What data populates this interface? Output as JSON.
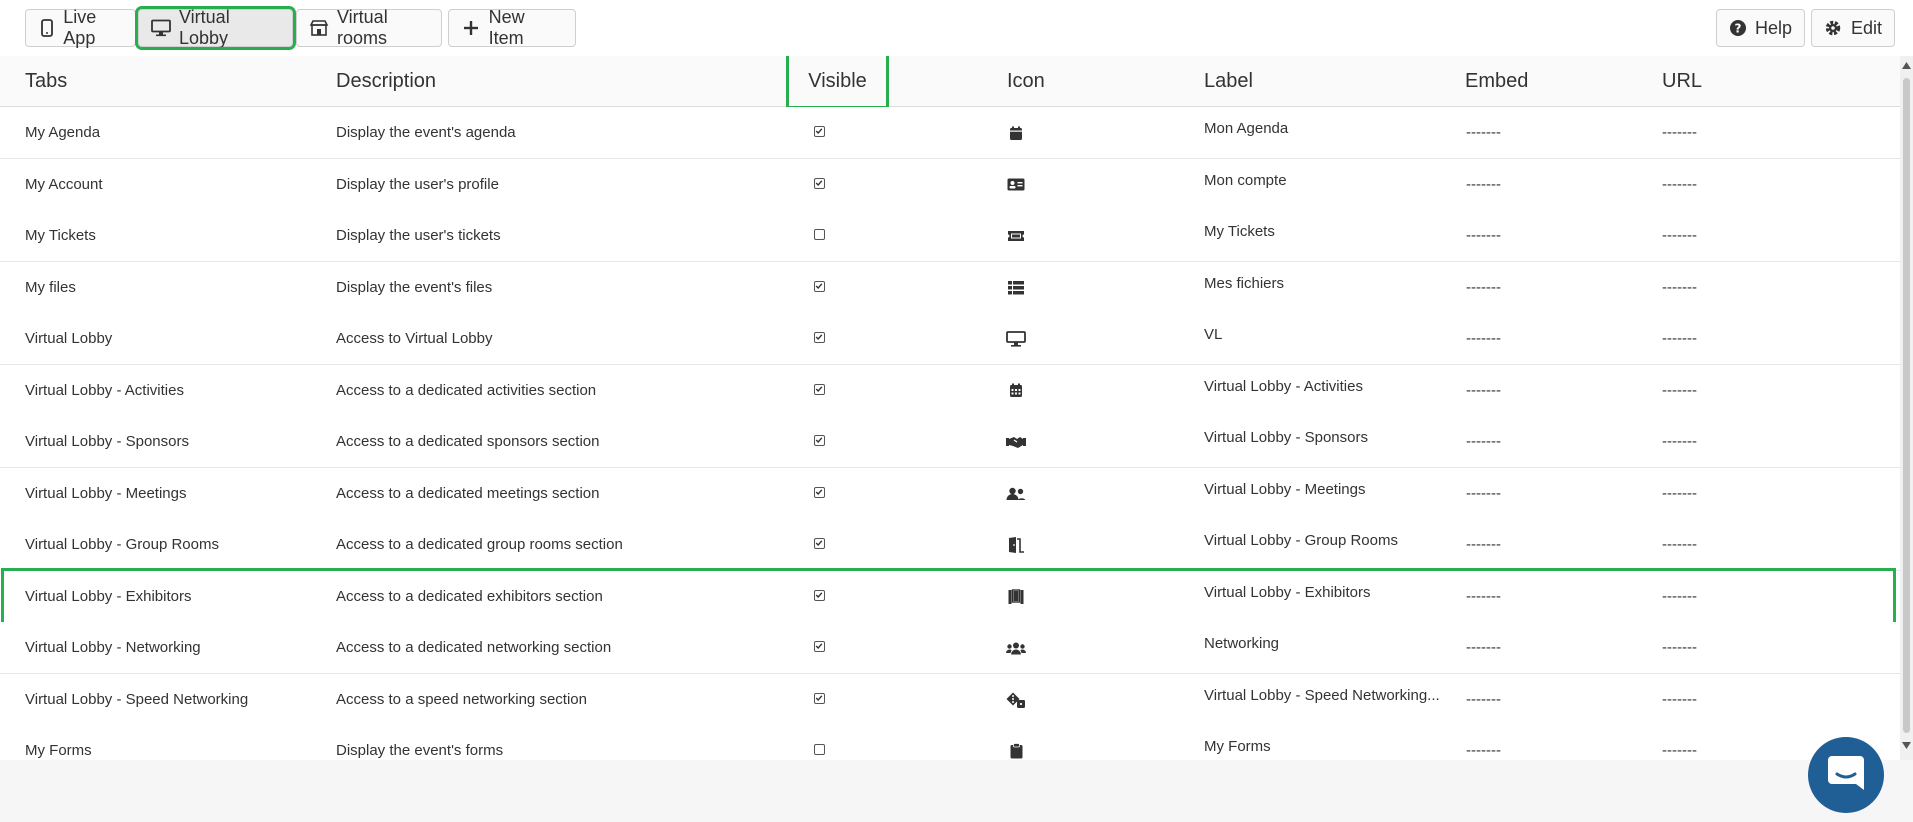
{
  "toolbar": {
    "live_app": "Live App",
    "virtual_lobby": "Virtual Lobby",
    "virtual_rooms": "Virtual rooms",
    "new_item": "New Item",
    "help": "Help",
    "edit": "Edit"
  },
  "table": {
    "headers": {
      "tabs": "Tabs",
      "description": "Description",
      "visible": "Visible",
      "icon": "Icon",
      "label": "Label",
      "embed": "Embed",
      "url": "URL"
    },
    "rows": [
      {
        "tab": "My Agenda",
        "description": "Display the event's agenda",
        "visible": true,
        "icon": "calendar-icon",
        "label": "Mon Agenda",
        "embed": "-------",
        "url": "-------"
      },
      {
        "tab": "My Account",
        "description": "Display the user's profile",
        "visible": true,
        "icon": "id-card-icon",
        "label": "Mon compte",
        "embed": "-------",
        "url": "-------"
      },
      {
        "tab": "My Tickets",
        "description": "Display the user's tickets",
        "visible": false,
        "icon": "ticket-icon",
        "label": "My Tickets",
        "embed": "-------",
        "url": "-------"
      },
      {
        "tab": "My files",
        "description": "Display the event's files",
        "visible": true,
        "icon": "list-icon",
        "label": "Mes fichiers",
        "embed": "-------",
        "url": "-------"
      },
      {
        "tab": "Virtual Lobby",
        "description": "Access to Virtual Lobby",
        "visible": true,
        "icon": "desktop-icon",
        "label": "VL",
        "embed": "-------",
        "url": "-------"
      },
      {
        "tab": "Virtual Lobby - Activities",
        "description": "Access to a dedicated activities section",
        "visible": true,
        "icon": "calendar-grid-icon",
        "label": "Virtual Lobby - Activities",
        "embed": "-------",
        "url": "-------"
      },
      {
        "tab": "Virtual Lobby - Sponsors",
        "description": "Access to a dedicated sponsors section",
        "visible": true,
        "icon": "handshake-icon",
        "label": "Virtual Lobby - Sponsors",
        "embed": "-------",
        "url": "-------"
      },
      {
        "tab": "Virtual Lobby - Meetings",
        "description": "Access to a dedicated meetings section",
        "visible": true,
        "icon": "user-friends-icon",
        "label": "Virtual Lobby - Meetings",
        "embed": "-------",
        "url": "-------"
      },
      {
        "tab": "Virtual Lobby - Group Rooms",
        "description": "Access to a dedicated group rooms section",
        "visible": true,
        "icon": "door-open-icon",
        "label": "Virtual Lobby - Group Rooms",
        "embed": "-------",
        "url": "-------"
      },
      {
        "tab": "Virtual Lobby - Exhibitors",
        "description": "Access to a dedicated exhibitors section",
        "visible": true,
        "icon": "booth-icon",
        "label": "Virtual Lobby - Exhibitors",
        "embed": "-------",
        "url": "-------"
      },
      {
        "tab": "Virtual Lobby - Networking",
        "description": "Access to a dedicated networking section",
        "visible": true,
        "icon": "users-icon",
        "label": "Networking",
        "embed": "-------",
        "url": "-------"
      },
      {
        "tab": "Virtual Lobby - Speed Networking",
        "description": "Access to a speed networking section",
        "visible": true,
        "icon": "dice-icon",
        "label": "Virtual Lobby - Speed Networking...",
        "embed": "-------",
        "url": "-------"
      },
      {
        "tab": "My Forms",
        "description": "Display the event's forms",
        "visible": false,
        "icon": "clipboard-icon",
        "label": "My Forms",
        "embed": "-------",
        "url": "-------"
      }
    ]
  },
  "colors": {
    "highlight": "#27ae4f",
    "chat_button": "#1f5f95"
  }
}
